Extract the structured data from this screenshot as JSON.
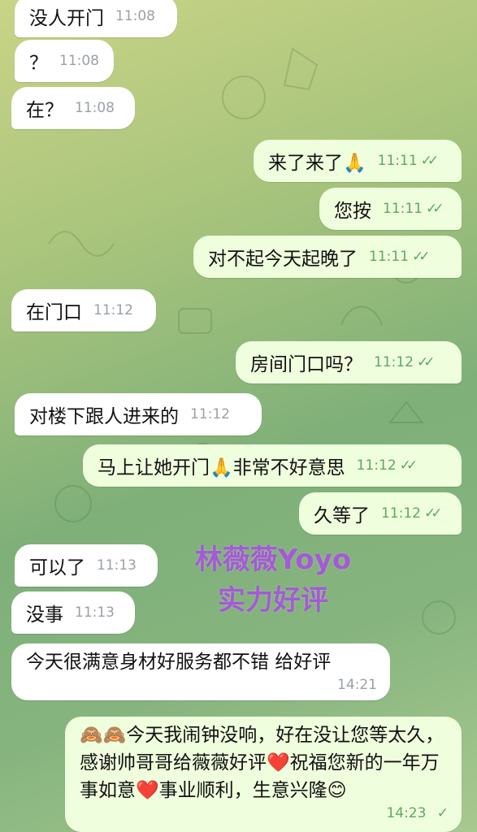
{
  "messages": [
    {
      "text": "没人开门",
      "time": "11:08"
    },
    {
      "text": "？",
      "time": "11:08"
    },
    {
      "text": "在？",
      "time": "11:08"
    },
    {
      "text": "来了来了🙏",
      "time": "11:11",
      "ticks": "✓✓"
    },
    {
      "text": "您按",
      "time": "11:11",
      "ticks": "✓✓"
    },
    {
      "text": "对不起今天起晚了",
      "time": "11:11",
      "ticks": "✓✓"
    },
    {
      "text": "在门口",
      "time": "11:12"
    },
    {
      "text": "房间门口吗？",
      "time": "11:12",
      "ticks": "✓✓"
    },
    {
      "text": "对楼下跟人进来的",
      "time": "11:12"
    },
    {
      "text": "马上让她开门🙏非常不好意思",
      "time": "11:12",
      "ticks": "✓✓"
    },
    {
      "text": "久等了",
      "time": "11:12",
      "ticks": "✓✓"
    },
    {
      "text": "可以了",
      "time": "11:13"
    },
    {
      "text": "没事",
      "time": "11:13"
    },
    {
      "text": "今天很满意身材好服务都不错 给好评",
      "time": "14:21"
    },
    {
      "text": "🙈🙈今天我闹钟没响，好在没让您等太久，感谢帅哥哥给薇薇好评❤️祝福您新的一年万事如意❤️事业顺利，生意兴隆😊",
      "time": "14:23",
      "ticks": "✓"
    }
  ],
  "watermark": {
    "line1": "林薇薇Yoyo",
    "line2": "实力好评"
  },
  "colors": {
    "incoming": "#ffffff",
    "outgoing": "#effedd",
    "tick": "#5fa860",
    "watermark": "#a45ad6"
  }
}
